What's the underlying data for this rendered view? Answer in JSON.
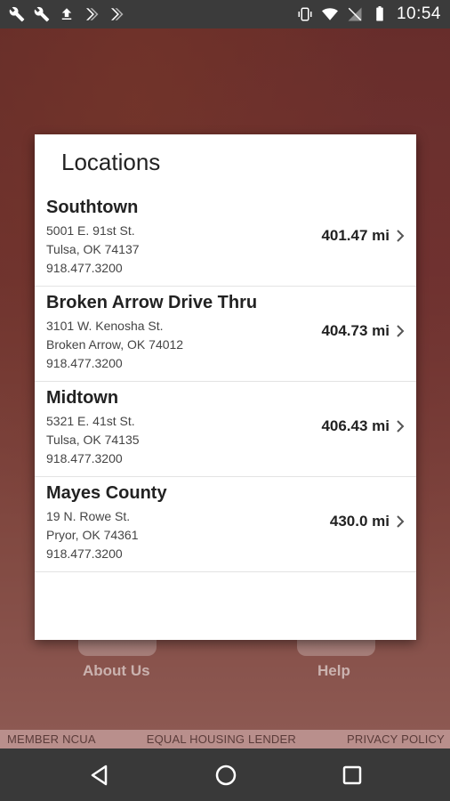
{
  "status_bar": {
    "time": "10:54",
    "left_icons": [
      "wrench-icon",
      "wrench-icon",
      "upload-icon",
      "flag-icon",
      "flag-icon"
    ],
    "right_icons": [
      "vibrate-icon",
      "wifi-icon",
      "signal-off-icon",
      "battery-icon"
    ]
  },
  "background": {
    "tiles": [
      {
        "label": "About Us"
      },
      {
        "label": "Help"
      }
    ]
  },
  "footer": {
    "links": [
      "MEMBER NCUA",
      "EQUAL HOUSING LENDER",
      "PRIVACY POLICY"
    ]
  },
  "dialog": {
    "title": "Locations",
    "locations": [
      {
        "name": "Southtown",
        "street": "5001 E. 91st St.",
        "city": "Tulsa, OK 74137",
        "phone": "918.477.3200",
        "distance": "401.47 mi"
      },
      {
        "name": "Broken Arrow Drive Thru",
        "street": "3101 W. Kenosha St.",
        "city": "Broken Arrow, OK 74012",
        "phone": "918.477.3200",
        "distance": "404.73 mi"
      },
      {
        "name": "Midtown",
        "street": "5321 E. 41st St.",
        "city": "Tulsa, OK 74135",
        "phone": "918.477.3200",
        "distance": "406.43 mi"
      },
      {
        "name": "Mayes County",
        "street": "19 N. Rowe St.",
        "city": "Pryor, OK 74361",
        "phone": "918.477.3200",
        "distance": "430.0 mi"
      }
    ]
  },
  "navbar": {
    "buttons": [
      "back-icon",
      "home-icon",
      "recents-icon"
    ]
  },
  "colors": {
    "status_bar": "#3b3b3b",
    "navbar": "#393939",
    "footer": "#b98f8c",
    "dialog": "#ffffff"
  }
}
